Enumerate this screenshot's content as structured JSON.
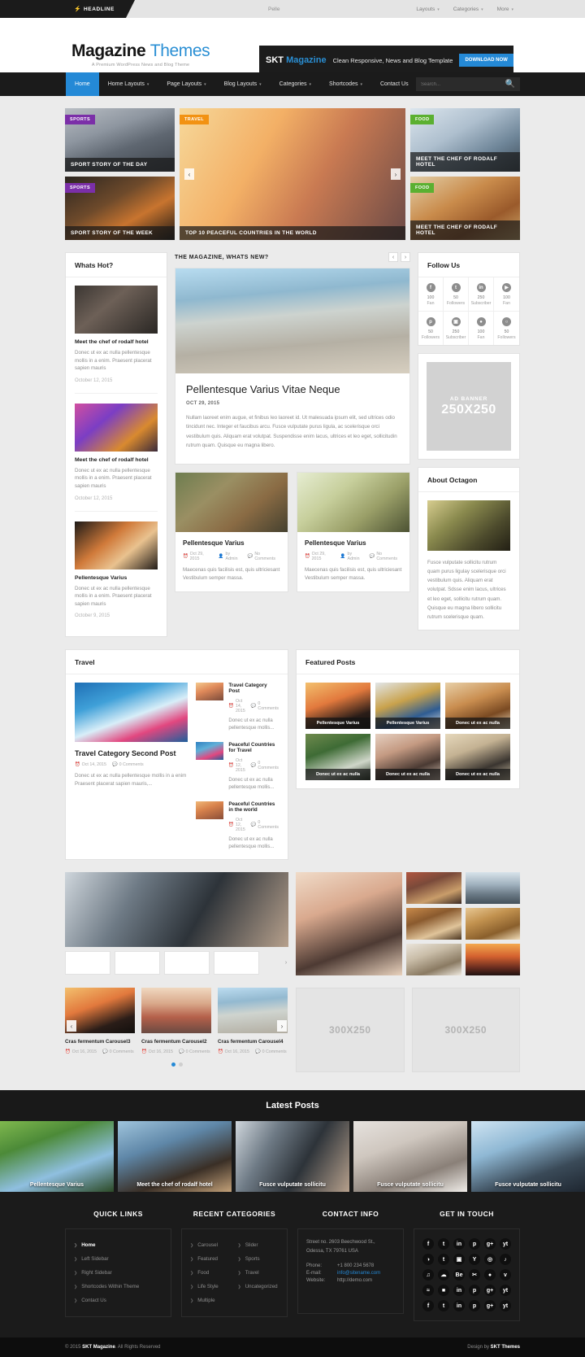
{
  "topbar": {
    "headline_label": "HEADLINE",
    "bolt_icon": "bolt-icon",
    "ticker_text": "Pelle",
    "menu": [
      {
        "label": "Layouts"
      },
      {
        "label": "Categories"
      },
      {
        "label": "More"
      }
    ]
  },
  "header": {
    "logo_main": "Magazine",
    "logo_accent": "Themes",
    "logo_tagline": "A Premium WordPress News and Blog Theme",
    "banner": {
      "brand_first": "SKT",
      "brand_accent": "Magazine",
      "text": "Clean Responsive, News and Blog Template",
      "button": "DOWNLOAD NOW"
    }
  },
  "mainnav": {
    "items": [
      {
        "label": "Home",
        "active": true
      },
      {
        "label": "Home Layouts",
        "caret": true
      },
      {
        "label": "Page Layouts",
        "caret": true
      },
      {
        "label": "Blog Layouts",
        "caret": true
      },
      {
        "label": "Categories",
        "caret": true
      },
      {
        "label": "Shortcodes",
        "caret": true
      },
      {
        "label": "Contact Us",
        "caret": false
      }
    ],
    "search_placeholder": "Search...",
    "search_value": ""
  },
  "slider": {
    "left": [
      {
        "category": "SPORTS",
        "title": "SPORT STORY OF THE DAY"
      },
      {
        "category": "SPORTS",
        "title": "SPORT STORY OF THE WEEK"
      }
    ],
    "center": {
      "category": "TRAVEL",
      "title": "TOP 10 PEACEFUL COUNTRIES IN THE WORLD"
    },
    "right": [
      {
        "category": "FOOD",
        "title": "MEET THE CHEF OF RODALF HOTEL"
      },
      {
        "category": "FOOD",
        "title": "MEET THE CHEF OF RODALF HOTEL"
      }
    ],
    "prev": "‹",
    "next": "›"
  },
  "whats_hot": {
    "title": "Whats Hot?",
    "items": [
      {
        "title": "Meet the chef of rodalf hotel",
        "excerpt": "Donec ut ex ac nulla pellentesque mollis in a enim. Praesent placerat sapien mauris",
        "date": "October 12, 2015"
      },
      {
        "title": "Meet the chef of rodalf hotel",
        "excerpt": "Donec ut ex ac nulla pellentesque mollis in a enim. Praesent placerat sapien mauris",
        "date": "October 12, 2015"
      },
      {
        "title": "Pellentesque Varius",
        "excerpt": "Donec ut ex ac nulla pellentesque mollis in a enim. Praesent placerat sapien mauris",
        "date": "October 9, 2015"
      }
    ]
  },
  "magazine": {
    "section_title": "THE MAGAZINE, WHATS NEW?",
    "prev": "‹",
    "next": "›",
    "feature": {
      "title": "Pellentesque Varius Vitae Neque",
      "date": "OCT 29, 2015",
      "body": "Nullam laoreet enim augue, et finibus leo laoreet id. Ut malesuada ipsum elit, sed ultrices odio tincidunt nec. Integer et faucibus arcu. Fusce vulputate purus ligula, ac scelerisque orci vestibulum quis. Aliquam erat volutpat. Suspendisse enim lacus, ultrices et leo eget, sollicitudin rutrum quam. Quisque eu magna libero."
    },
    "cards": [
      {
        "title": "Pellentesque Varius",
        "meta_date": "Oct 29, 2015",
        "meta_author": "by Admin",
        "meta_comments": "No Comments",
        "text": "Maecenas quis facilisis est, quis ultriciesant Vestibulum semper massa."
      },
      {
        "title": "Pellentesque Varius",
        "meta_date": "Oct 29, 2015",
        "meta_author": "by Admin",
        "meta_comments": "No Comments",
        "text": "Maecenas quis facilisis est, quis ultriciesant Vestibulum semper massa."
      }
    ]
  },
  "follow_us": {
    "title": "Follow Us",
    "items": [
      {
        "icon": "facebook-icon",
        "glyph": "f",
        "count": "100",
        "label": "Fan"
      },
      {
        "icon": "twitter-icon",
        "glyph": "t",
        "count": "50",
        "label": "Followers"
      },
      {
        "icon": "linkedin-icon",
        "glyph": "in",
        "count": "250",
        "label": "Subscriber"
      },
      {
        "icon": "youtube-icon",
        "glyph": "▶",
        "count": "100",
        "label": "Fan"
      },
      {
        "icon": "pinterest-icon",
        "glyph": "p",
        "count": "50",
        "label": "Followers"
      },
      {
        "icon": "instagram-icon",
        "glyph": "▣",
        "count": "250",
        "label": "Subscriber"
      },
      {
        "icon": "flickr-icon",
        "glyph": "●",
        "count": "100",
        "label": "Fan"
      },
      {
        "icon": "dribbble-icon",
        "glyph": "○",
        "count": "50",
        "label": "Followers"
      }
    ]
  },
  "ad_sidebar": {
    "label": "AD BANNER",
    "size": "250X250"
  },
  "about": {
    "title": "About Octagon",
    "text": "Fusce vulputate sollicitu rutrum quam purus ligulay scelerisque orci vestibulum quis. Aliquam erat volutpat. Sdsse enim lacus, ultrices et leo eget, sollicitu rutrum quam. Quisque eu magna libero sollicitu rutrum scelerisque quam."
  },
  "travel": {
    "title": "Travel",
    "main": {
      "title": "Travel Category Second Post",
      "meta_date": "Oct 14, 2015",
      "meta_comments": "0 Comments",
      "text": "Donec ut ex ac nulla pellentesque mollis in a enim Praesent placerat sapien mauris,..."
    },
    "list": [
      {
        "title": "Travel Category Post",
        "meta_date": "Oct 14, 2015",
        "meta_comments": "0 Comments",
        "text": "Donec ut ex ac nulla pellentesque mollis..."
      },
      {
        "title": "Peaceful Countries for Travel",
        "meta_date": "Oct 12, 2015",
        "meta_comments": "0 Comments",
        "text": "Donec ut ex ac nulla pellentesque mollis..."
      },
      {
        "title": "Peaceful Countries in the world",
        "meta_date": "Oct 12, 2015",
        "meta_comments": "0 Comments",
        "text": "Donec ut ex ac nulla pellentesque mollis..."
      }
    ]
  },
  "featured_posts": {
    "title": "Featured Posts",
    "items": [
      {
        "caption": "Pellentesque Varius"
      },
      {
        "caption": "Pellentesque Varius"
      },
      {
        "caption": "Donec ut ex ac nulla"
      },
      {
        "caption": "Donec ut ex ac nulla"
      },
      {
        "caption": "Donec ut ex ac nulla"
      },
      {
        "caption": "Donec ut ex ac nulla"
      }
    ]
  },
  "gallery": {
    "next": "›"
  },
  "carousel": {
    "prev": "‹",
    "next": "›",
    "items": [
      {
        "title": "Cras fermentum Carousel3",
        "meta_date": "Oct 16, 2015",
        "meta_comments": "0 Comments"
      },
      {
        "title": "Cras fermentum Carousel2",
        "meta_date": "Oct 16, 2015",
        "meta_comments": "0 Comments"
      },
      {
        "title": "Cras fermentum Carousel4",
        "meta_date": "Oct 16, 2015",
        "meta_comments": "0 Comments"
      }
    ]
  },
  "ads_bottom": [
    {
      "size": "300X250"
    },
    {
      "size": "300X250"
    }
  ],
  "latest_posts": {
    "title": "Latest Posts",
    "items": [
      {
        "caption": "Pellentesque Varius"
      },
      {
        "caption": "Meet the chef of rodalf hotel"
      },
      {
        "caption": "Fusce vulputate sollicitu"
      },
      {
        "caption": "Fusce vulputate sollicitu"
      },
      {
        "caption": "Fusce vulputate sollicitu"
      }
    ]
  },
  "footer": {
    "quick_links": {
      "title": "QUICK LINKS",
      "items": [
        "Home",
        "Left Sidebar",
        "Right Sidebar",
        "Shortcodes Within Theme",
        "Contact Us"
      ]
    },
    "recent_categories": {
      "title": "RECENT CATEGORIES",
      "items": [
        "Carousel",
        "Slider",
        "Featured",
        "Sports",
        "Food",
        "Travel",
        "Life Style",
        "Uncategorized",
        "Multiple"
      ]
    },
    "contact_info": {
      "title": "CONTACT INFO",
      "address_line1": "Street no. 2603 Beechwood St.,",
      "address_line2": "Odessa, TX 79761 USA",
      "phone_key": "Phone:",
      "phone_val": "+1 800 234 5678",
      "email_key": "E-mail:",
      "email_val": "info@sitename.com",
      "website_key": "Website:",
      "website_val": "http://demo.com"
    },
    "get_in_touch": {
      "title": "GET IN TOUCH",
      "icons": [
        "f",
        "t",
        "in",
        "p",
        "g+",
        "yt",
        "◑",
        "t",
        "▣",
        "Y",
        "◎",
        "♪",
        "♫",
        "☁",
        "Be",
        "✂",
        "●",
        "v",
        "≈",
        "■",
        "in",
        "p",
        "g+",
        "yt",
        "f",
        "t",
        "in",
        "p",
        "g+",
        "yt"
      ]
    }
  },
  "copyright": {
    "left_prefix": "© 2015 ",
    "left_brand": "SKT Magazine",
    "left_suffix": ". All Rights Reserved",
    "right_prefix": "Design by ",
    "right_brand": "SKT Themes"
  },
  "colors": {
    "accent": "#2489d6",
    "dark": "#1b1b1b",
    "sports": "#7b2fa8",
    "travel": "#f29213",
    "food": "#5bb031"
  }
}
